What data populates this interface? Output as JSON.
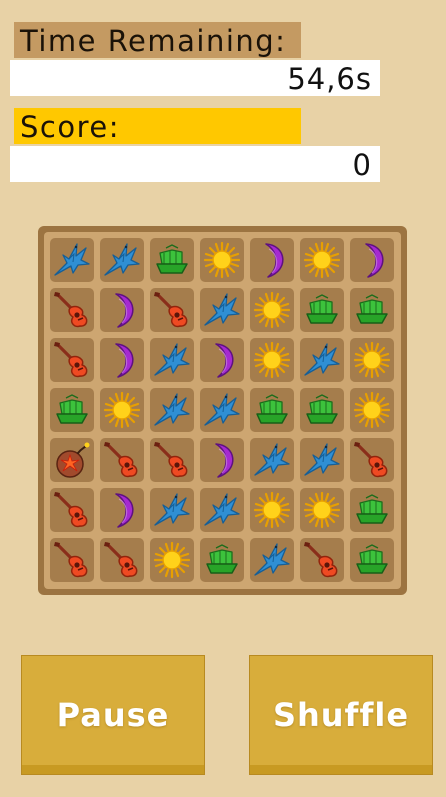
{
  "time": {
    "label": "Time Remaining:",
    "value": "54,6s"
  },
  "score": {
    "label": "Score:",
    "value": "0"
  },
  "colors": {
    "background": "#e8d2a6",
    "time_label_bg": "#c49a62",
    "score_label_bg": "#ffc800",
    "button_bg": "#d8ad3b",
    "board_frame": "#9c7441",
    "tile_bg": "#a57d4c"
  },
  "board": {
    "rows": 7,
    "cols": 7,
    "grid": [
      [
        "bird",
        "bird",
        "ship",
        "sun",
        "moon",
        "sun",
        "moon"
      ],
      [
        "guitar",
        "moon",
        "guitar",
        "bird",
        "sun",
        "ship",
        "ship"
      ],
      [
        "guitar",
        "moon",
        "bird",
        "moon",
        "sun",
        "bird",
        "sun"
      ],
      [
        "ship",
        "sun",
        "bird",
        "bird",
        "ship",
        "ship",
        "sun"
      ],
      [
        "bomb",
        "guitar",
        "guitar",
        "moon",
        "bird",
        "bird",
        "guitar"
      ],
      [
        "guitar",
        "moon",
        "bird",
        "bird",
        "sun",
        "sun",
        "ship"
      ],
      [
        "guitar",
        "guitar",
        "sun",
        "ship",
        "bird",
        "guitar",
        "ship"
      ]
    ]
  },
  "buttons": {
    "pause": "Pause",
    "shuffle": "Shuffle"
  }
}
